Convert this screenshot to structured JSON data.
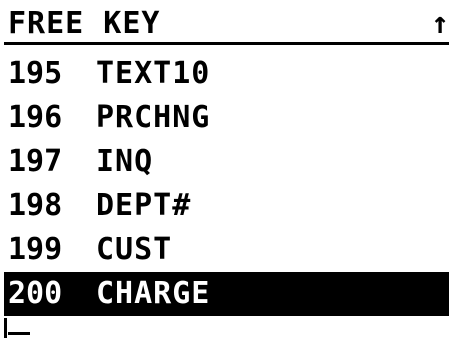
{
  "header": {
    "title": "FREE KEY",
    "scroll_indicator": "↑"
  },
  "list": {
    "items": [
      {
        "code": "195",
        "label": "TEXT10",
        "selected": false
      },
      {
        "code": "196",
        "label": "PRCHNG",
        "selected": false
      },
      {
        "code": "197",
        "label": "INQ",
        "selected": false
      },
      {
        "code": "198",
        "label": "DEPT#",
        "selected": false
      },
      {
        "code": "199",
        "label": "CUST",
        "selected": false
      },
      {
        "code": "200",
        "label": "CHARGE",
        "selected": true
      }
    ]
  },
  "input": {
    "value": ""
  }
}
